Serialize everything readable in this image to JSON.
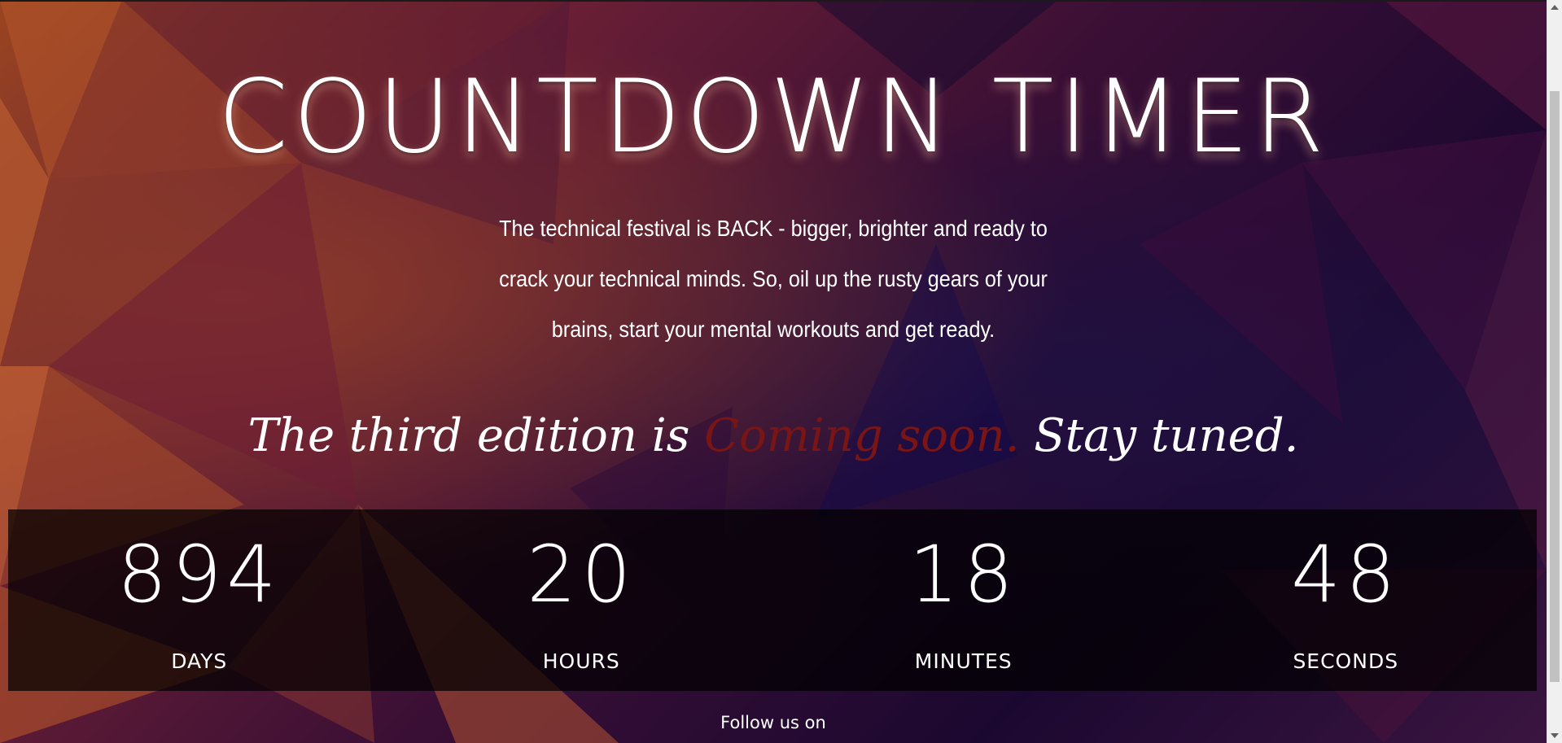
{
  "header": {
    "title": "COUNTDOWN TIMER"
  },
  "intro": {
    "text": "The technical festival is BACK - bigger, brighter and ready to crack your technical minds. So, oil up the rusty gears of your brains, start your mental workouts and get ready."
  },
  "tagline": {
    "prefix": "The third edition is ",
    "highlight": "Coming soon.",
    "suffix": " Stay tuned."
  },
  "countdown": {
    "days": {
      "value": "894",
      "label": "DAYS"
    },
    "hours": {
      "value": "20",
      "label": "HOURS"
    },
    "minutes": {
      "value": "18",
      "label": "MINUTES"
    },
    "seconds": {
      "value": "48",
      "label": "SECONDS"
    }
  },
  "footer": {
    "follow_text": "Follow us on"
  },
  "colors": {
    "highlight": "#7a1515",
    "timer_band": "rgba(0,0,0,0.72)"
  }
}
